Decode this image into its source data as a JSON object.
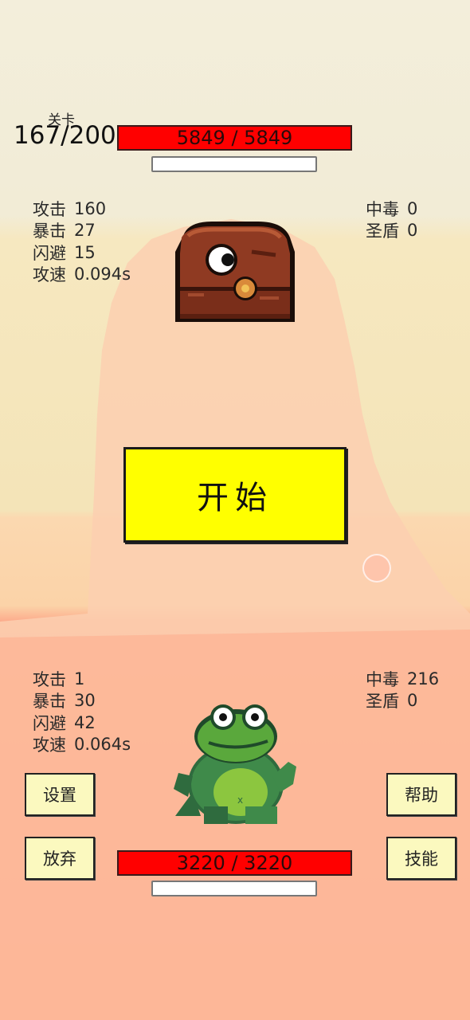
{
  "level": {
    "label": "关卡",
    "value": "167/200"
  },
  "enemy": {
    "hp_text": "5849 / 5849",
    "stats_left": [
      {
        "label": "攻击",
        "value": "160"
      },
      {
        "label": "暴击",
        "value": "27"
      },
      {
        "label": "闪避",
        "value": "15"
      },
      {
        "label": "攻速",
        "value": "0.094s"
      }
    ],
    "stats_right": [
      {
        "label": "中毒",
        "value": "0"
      },
      {
        "label": "圣盾",
        "value": "0"
      }
    ],
    "sprite_icon": "treasure-chest-monster-icon"
  },
  "player": {
    "hp_text": "3220 / 3220",
    "stats_left": [
      {
        "label": "攻击",
        "value": "1"
      },
      {
        "label": "暴击",
        "value": "30"
      },
      {
        "label": "闪避",
        "value": "42"
      },
      {
        "label": "攻速",
        "value": "0.064s"
      }
    ],
    "stats_right": [
      {
        "label": "中毒",
        "value": "216"
      },
      {
        "label": "圣盾",
        "value": "0"
      }
    ],
    "sprite_icon": "frog-icon"
  },
  "buttons": {
    "start": "开始",
    "settings": "设置",
    "give_up": "放弃",
    "help": "帮助",
    "skills": "技能"
  },
  "colors": {
    "hp_bar": "#ff0000",
    "start_button": "#ffff00",
    "side_button": "#fbf9bf"
  }
}
